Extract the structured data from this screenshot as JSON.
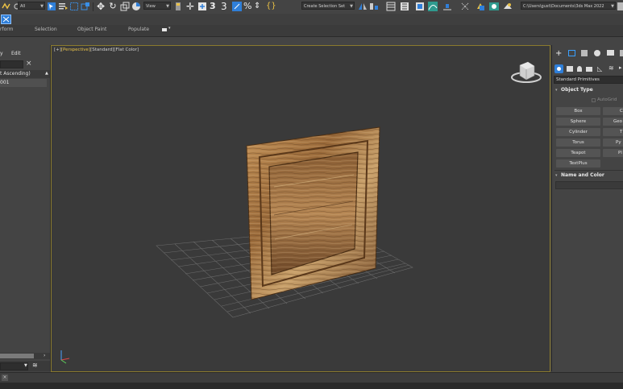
{
  "toolbar": {
    "filter_dropdown": "All",
    "view_dropdown": "View",
    "angle_snap_label": "3",
    "percent_snap_label": "%",
    "selection_set_dropdown": "Create Selection Set",
    "project_path": "C:\\Users\\gust\\Documents\\3ds Max 2022"
  },
  "ribbon": {
    "tabs": [
      "rform",
      "Selection",
      "Object Paint",
      "Populate"
    ]
  },
  "scene_explorer": {
    "menu_edit": "Edit",
    "menu_prev": "y",
    "sort_label": "t Ascending)",
    "row_label": "001"
  },
  "viewport": {
    "label_plus": "[+]",
    "label_view": "[Perspective]",
    "label_shading": "[Standard]",
    "label_color": "[Flat Color]"
  },
  "command_panel": {
    "category_dropdown": "Standard Primitives",
    "object_type_title": "Object Type",
    "autogrid_label": "AutoGrid",
    "primitives": [
      {
        "left": "Box",
        "right": "C"
      },
      {
        "left": "Sphere",
        "right": "Geo"
      },
      {
        "left": "Cylinder",
        "right": "T"
      },
      {
        "left": "Torus",
        "right": "Py"
      },
      {
        "left": "Teapot",
        "right": "Pl"
      },
      {
        "left": "TextPlus",
        "right": ""
      }
    ],
    "name_color_title": "Name and Color"
  },
  "colors": {
    "accent": "#2f7fd9",
    "viewport_border": "#8a7a2e",
    "viewport_bg": "#3a3a3a",
    "active_label": "#e8c24a"
  }
}
